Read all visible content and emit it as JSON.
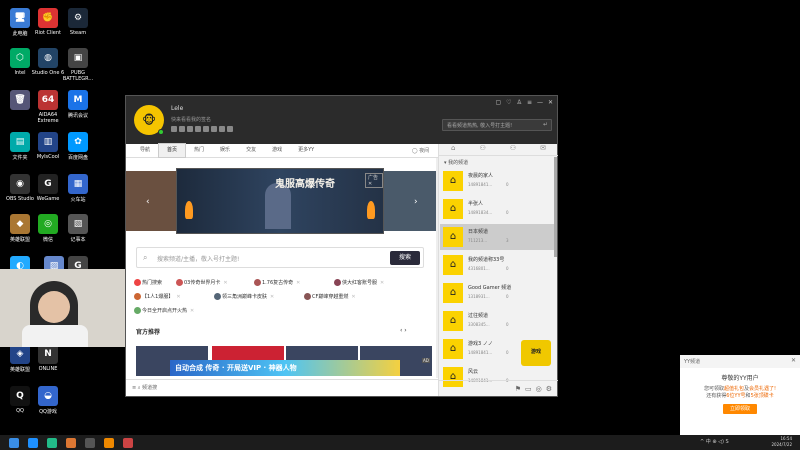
{
  "desktop": {
    "icons": [
      {
        "label": "此电脑",
        "glyph": "🖥",
        "color": "#3a7bd5"
      },
      {
        "label": "Riot Client",
        "glyph": "✊",
        "color": "#d33"
      },
      {
        "label": "Steam",
        "glyph": "⚙",
        "color": "#1b2838"
      },
      {
        "label": "Intel",
        "glyph": "⬡",
        "color": "#0a6"
      },
      {
        "label": "Studio One 6",
        "glyph": "◍",
        "color": "#246"
      },
      {
        "label": "PUBG BATTLEGR...",
        "glyph": "▣",
        "color": "#444"
      },
      {
        "label": "",
        "glyph": "🗑",
        "color": "#557"
      },
      {
        "label": "AIDA64 Extreme",
        "glyph": "64",
        "color": "#b33"
      },
      {
        "label": "腾讯会议",
        "glyph": "M",
        "color": "#1a73e8"
      },
      {
        "label": "文件夹",
        "glyph": "▤",
        "color": "#0aa"
      },
      {
        "label": "MyIsCool",
        "glyph": "▥",
        "color": "#248"
      },
      {
        "label": "百度网盘",
        "glyph": "✿",
        "color": "#09f"
      },
      {
        "label": "OBS Studio",
        "glyph": "◉",
        "color": "#333"
      },
      {
        "label": "WeGame",
        "glyph": "G",
        "color": "#222"
      },
      {
        "label": "火车站",
        "glyph": "▦",
        "color": "#36c"
      },
      {
        "label": "英雄联盟",
        "glyph": "◆",
        "color": "#a73"
      },
      {
        "label": "微信",
        "glyph": "◎",
        "color": "#2a2"
      },
      {
        "label": "记事本",
        "glyph": "▧",
        "color": "#555"
      },
      {
        "label": "",
        "glyph": "◐",
        "color": "#2af"
      },
      {
        "label": "",
        "glyph": "▨",
        "color": "#68c"
      },
      {
        "label": "G",
        "glyph": "G",
        "color": "#444"
      },
      {
        "label": "英雄联盟",
        "glyph": "◈",
        "color": "#248"
      },
      {
        "label": "ONLINE",
        "glyph": "N",
        "color": "#333"
      },
      {
        "label": "QQ",
        "glyph": "Q",
        "color": "#111"
      },
      {
        "label": "QQ游戏",
        "glyph": "◒",
        "color": "#36c"
      }
    ]
  },
  "client": {
    "user": {
      "name": "Lele",
      "signature": "快来看看我的签名",
      "avatar_glyph": "🐵"
    },
    "window_controls": [
      "▢",
      "♡",
      "♙",
      "≡",
      "—",
      "✕"
    ],
    "search_placeholder": "看看频道热热, 敬入号打主题!",
    "search_enter": "↵",
    "nav": [
      "导航",
      "首页",
      "热门",
      "娱乐",
      "交友",
      "游戏",
      "更多YY"
    ],
    "nav_active_index": 1,
    "theme_label": "◯ 夜间",
    "banner": {
      "title": "鬼服高爆传奇",
      "tag": "广告 ✕",
      "left_arrow": "‹",
      "right_arrow": "›"
    },
    "search": {
      "placeholder": "搜索频道/主播，敬入号打主题!",
      "button": "搜索",
      "icon": "search-icon"
    },
    "tags": [
      {
        "label": "热门搜索",
        "color": "#e44"
      },
      {
        "label": "03传奇世界月卡",
        "color": "#c55"
      },
      {
        "label": "1.76复古传奇",
        "color": "#a55"
      },
      {
        "label": "侠大红客账号服",
        "color": "#845"
      },
      {
        "label": "【1人1爆服】",
        "color": "#c63"
      },
      {
        "label": "领三角洲巅峰卡皮肤",
        "color": "#567"
      },
      {
        "label": "CF巅峰穿越重燃",
        "color": "#855"
      },
      {
        "label": "今日全开启点开火热",
        "color": "#6a6"
      }
    ],
    "rec_title": "官方推荐",
    "rec_arrows": "‹  ›",
    "ad_strip": "自动合成 传奇 · 开局送VIP · 神器人物",
    "ad_tag": "AD",
    "bottom_label": "≡   ⌕ 频道搜",
    "side": {
      "tabs": [
        "⌂",
        "⚇",
        "⚇",
        "✉"
      ],
      "heading": "▾ 我的频道",
      "channels": [
        {
          "name": "夜晨的家人",
          "sub": "14891841...",
          "count": "0"
        },
        {
          "name": "半张人",
          "sub": "14891834...",
          "count": "0"
        },
        {
          "name": "日本频道",
          "sub": "711213...",
          "count": "3"
        },
        {
          "name": "我的频道称33号",
          "sub": "4316801...",
          "count": "0"
        },
        {
          "name": "Good Gamer 频道",
          "sub": "1318931...",
          "count": "0"
        },
        {
          "name": "过往频道",
          "sub": "3308345...",
          "count": "0"
        },
        {
          "name": "游戏3  ノノ",
          "sub": "14891841...",
          "count": "0"
        },
        {
          "name": "风云",
          "sub": "14891841...",
          "count": "0"
        }
      ],
      "selected_index": 2,
      "bottom_icons": [
        "⚑",
        "▭",
        "◎",
        "⚙"
      ],
      "game_badge": "游戏"
    }
  },
  "notification": {
    "head": "YY频道",
    "close": "✕",
    "title": "尊敬的YY用户",
    "line1_a": "您可领取",
    "line1_b": "超值礼包",
    "line1_c": "及",
    "line1_d": "会员礼遇了!",
    "line2_a": "还有获得",
    "line2_b": "6位YY号",
    "line2_c": "和",
    "line2_d": "5张顶碟卡",
    "button": "立即领取"
  },
  "taskbar": {
    "icons": [
      "#1e90ff",
      "#2b8",
      "#d73",
      "#555",
      "#e80",
      "#c44"
    ],
    "tray": "^ 中 ⊕ ◁) S",
    "time": "16:54",
    "date": "2024/7/22"
  }
}
